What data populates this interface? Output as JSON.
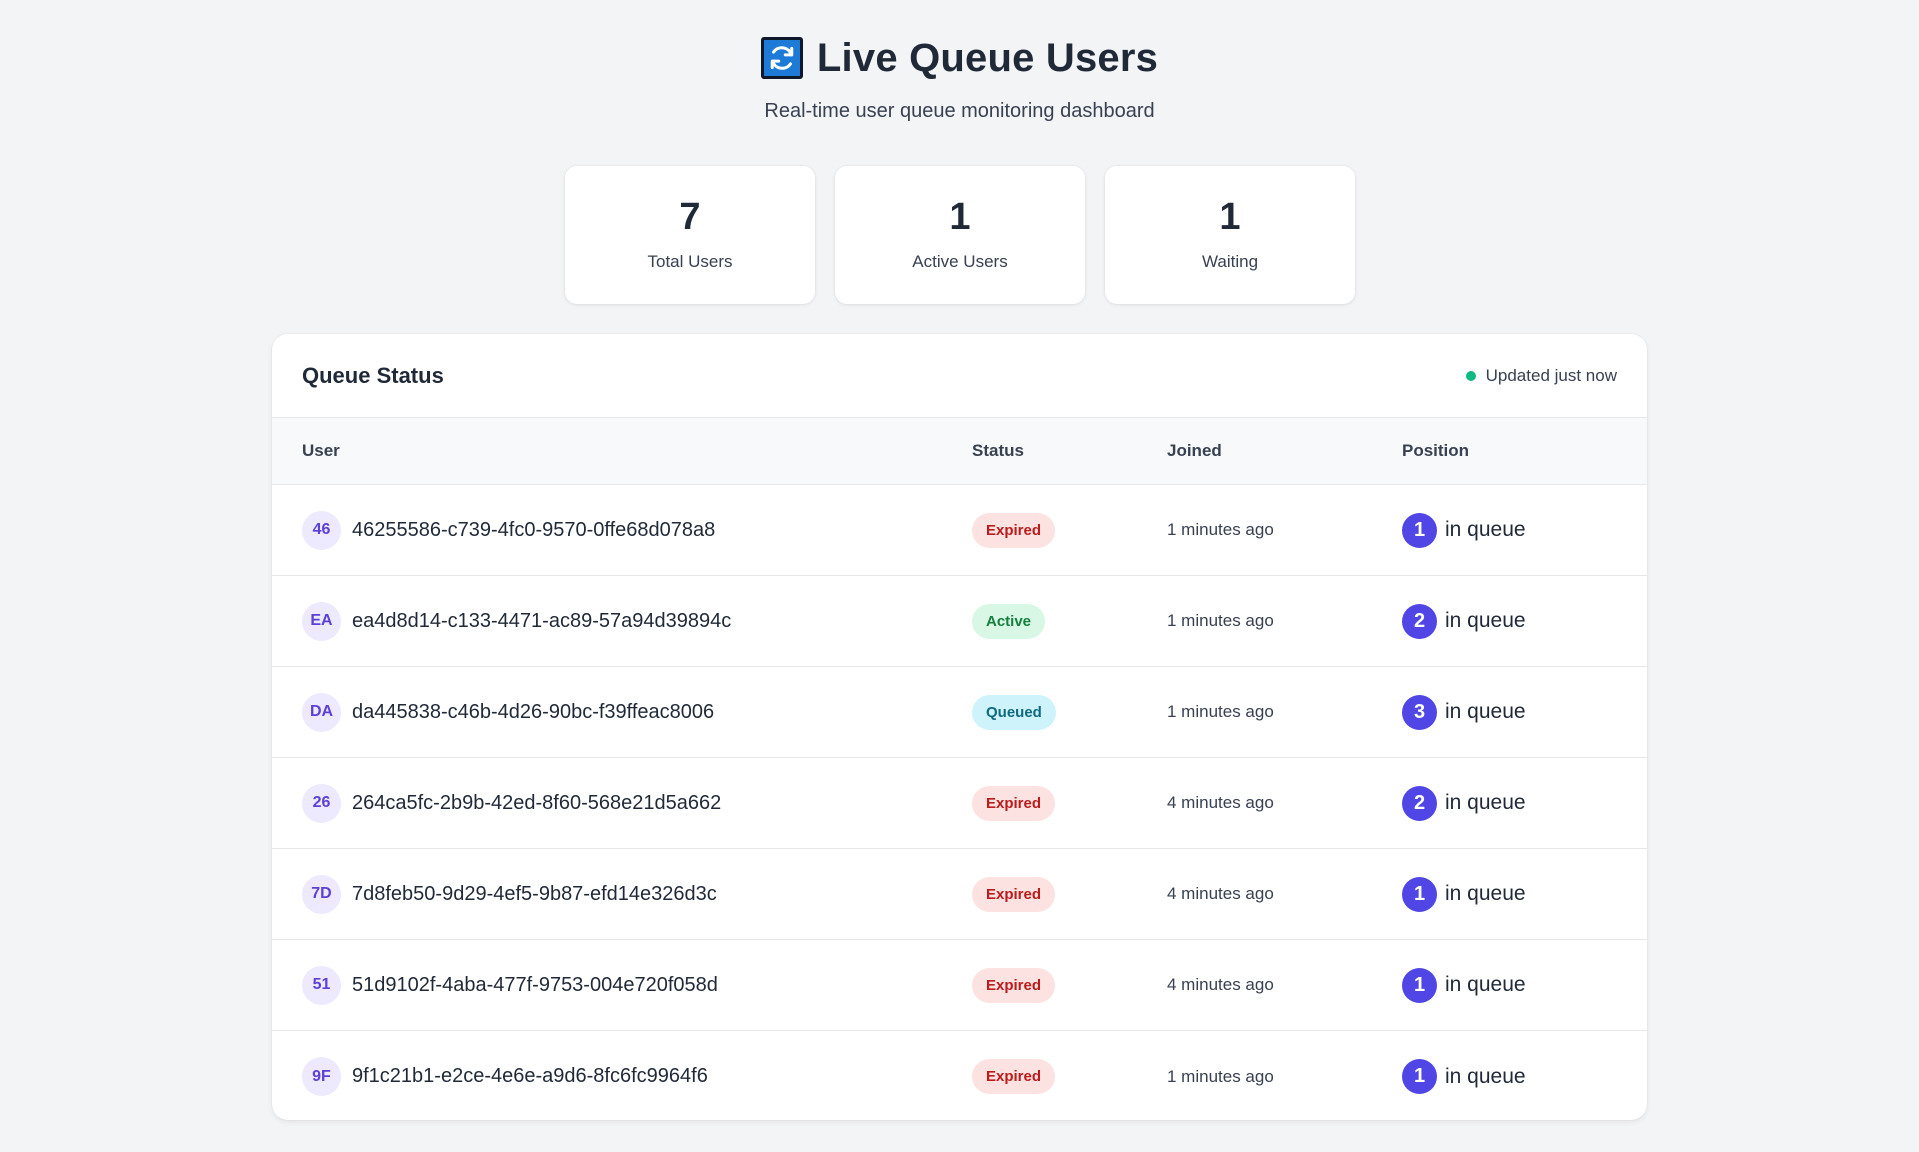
{
  "header": {
    "icon": "refresh-icon",
    "title": "Live Queue Users",
    "subtitle": "Real-time user queue monitoring dashboard"
  },
  "stats": [
    {
      "value": "7",
      "label": "Total Users"
    },
    {
      "value": "1",
      "label": "Active Users"
    },
    {
      "value": "1",
      "label": "Waiting"
    }
  ],
  "queue": {
    "title": "Queue Status",
    "updated": "Updated just now",
    "live_color": "#10b981",
    "columns": {
      "user": "User",
      "status": "Status",
      "joined": "Joined",
      "position": "Position"
    },
    "position_suffix": "in queue",
    "rows": [
      {
        "initials": "46",
        "id": "46255586-c739-4fc0-9570-0ffe68d078a8",
        "status": "Expired",
        "status_kind": "expired",
        "joined": "1 minutes ago",
        "position": "1"
      },
      {
        "initials": "EA",
        "id": "ea4d8d14-c133-4471-ac89-57a94d39894c",
        "status": "Active",
        "status_kind": "active",
        "joined": "1 minutes ago",
        "position": "2"
      },
      {
        "initials": "DA",
        "id": "da445838-c46b-4d26-90bc-f39ffeac8006",
        "status": "Queued",
        "status_kind": "queued",
        "joined": "1 minutes ago",
        "position": "3"
      },
      {
        "initials": "26",
        "id": "264ca5fc-2b9b-42ed-8f60-568e21d5a662",
        "status": "Expired",
        "status_kind": "expired",
        "joined": "4 minutes ago",
        "position": "2"
      },
      {
        "initials": "7D",
        "id": "7d8feb50-9d29-4ef5-9b87-efd14e326d3c",
        "status": "Expired",
        "status_kind": "expired",
        "joined": "4 minutes ago",
        "position": "1"
      },
      {
        "initials": "51",
        "id": "51d9102f-4aba-477f-9753-004e720f058d",
        "status": "Expired",
        "status_kind": "expired",
        "joined": "4 minutes ago",
        "position": "1"
      },
      {
        "initials": "9F",
        "id": "9f1c21b1-e2ce-4e6e-a9d6-8fc6fc9964f6",
        "status": "Expired",
        "status_kind": "expired",
        "joined": "1 minutes ago",
        "position": "1"
      }
    ]
  },
  "colors": {
    "accent": "#4f46e5",
    "expired_bg": "#fde2e2",
    "active_bg": "#d9f7e5",
    "queued_bg": "#cff3fb",
    "title_icon": "#1d7ad6"
  }
}
